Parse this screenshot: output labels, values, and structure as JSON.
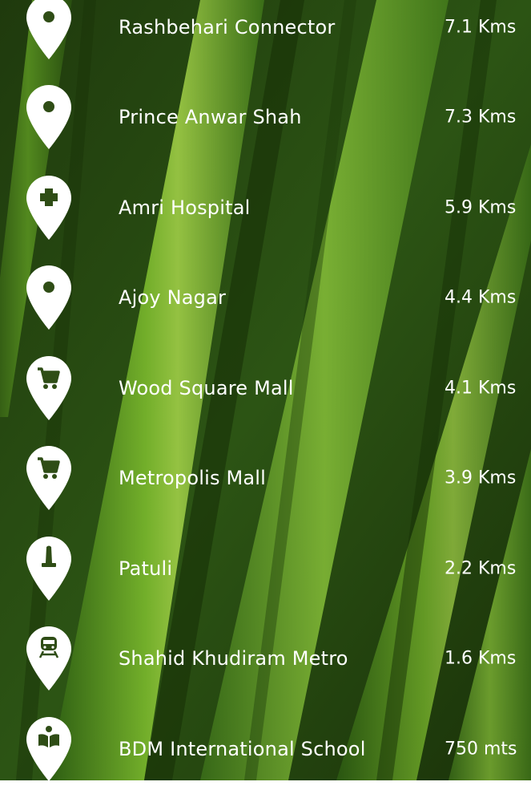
{
  "colors": {
    "text": "#ffffff",
    "pin": "#ffffff",
    "pin_symbol": "#2f4d16"
  },
  "locations": [
    {
      "name": "Rashbehari Connector",
      "distance": "7.1 Kms",
      "icon": "location-pin-icon"
    },
    {
      "name": "Prince Anwar Shah",
      "distance": "7.3 Kms",
      "icon": "location-pin-icon"
    },
    {
      "name": "Amri Hospital",
      "distance": "5.9 Kms",
      "icon": "hospital-cross-icon"
    },
    {
      "name": "Ajoy Nagar",
      "distance": "4.4 Kms",
      "icon": "location-pin-icon"
    },
    {
      "name": "Wood Square Mall",
      "distance": "4.1 Kms",
      "icon": "shopping-cart-icon"
    },
    {
      "name": "Metropolis Mall",
      "distance": "3.9 Kms",
      "icon": "shopping-cart-icon"
    },
    {
      "name": "Patuli",
      "distance": "2.2 Kms",
      "icon": "landmark-monument-icon"
    },
    {
      "name": "Shahid Khudiram Metro",
      "distance": "1.6 Kms",
      "icon": "metro-train-icon"
    },
    {
      "name": "BDM International School",
      "distance": "750 mts",
      "icon": "school-book-icon"
    }
  ]
}
